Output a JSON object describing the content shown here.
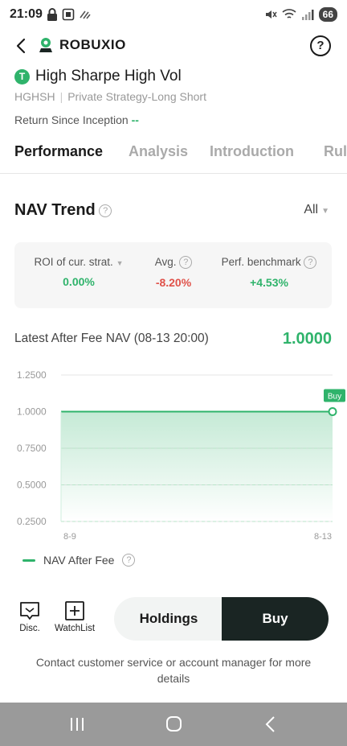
{
  "status_bar": {
    "time": "21:09",
    "battery": "66"
  },
  "header": {
    "brand": "ROBUXIO",
    "help_label": "?"
  },
  "strategy": {
    "badge": "T",
    "title": "High Sharpe High Vol",
    "code": "HGHSH",
    "separator": "|",
    "type": "Private Strategy-Long Short",
    "inception_label": "Return Since Inception",
    "inception_value": "--"
  },
  "tabs": [
    {
      "label": "Performance"
    },
    {
      "label": "Analysis"
    },
    {
      "label": "Introduction"
    },
    {
      "label": "Rul"
    }
  ],
  "nav_trend": {
    "title": "NAV Trend",
    "help": "?",
    "period": "All",
    "stats": [
      {
        "label": "ROI of cur. strat.",
        "value": "0.00%",
        "color": "#2fb36b",
        "icon": "caret-down-icon"
      },
      {
        "label": "Avg.",
        "value": "-8.20%",
        "color": "#e0524a",
        "icon": "help-icon"
      },
      {
        "label": "Perf. benchmark",
        "value": "+4.53%",
        "color": "#2fb36b",
        "icon": "help-icon"
      }
    ],
    "latest_label": "Latest After Fee NAV (08-13 20:00)",
    "latest_value": "1.0000",
    "legend_label": "NAV After Fee"
  },
  "chart_data": {
    "type": "area",
    "x": [
      "8-9",
      "8-13"
    ],
    "x_ticks": [
      "8-9",
      "8-13"
    ],
    "y_ticks": [
      "1.2500",
      "1.0000",
      "0.7500",
      "0.5000",
      "0.2500"
    ],
    "ylim": [
      0.25,
      1.25
    ],
    "series": [
      {
        "name": "NAV After Fee",
        "values": [
          1.0,
          1.0
        ],
        "color": "#2fb36b"
      }
    ],
    "annotation": "Buy",
    "grid": true
  },
  "actions": {
    "disc_label": "Disc.",
    "watchlist_label": "WatchList",
    "holdings_label": "Holdings",
    "buy_label": "Buy"
  },
  "contact_text": "Contact customer service or account manager for more details"
}
